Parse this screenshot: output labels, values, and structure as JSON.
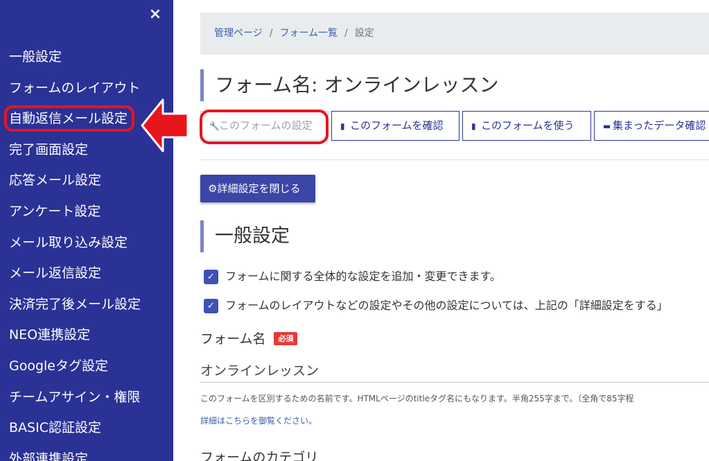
{
  "sidebar": {
    "close_label": "×",
    "items": [
      {
        "label": "一般設定"
      },
      {
        "label": "フォームのレイアウト"
      },
      {
        "label": "自動返信メール設定"
      },
      {
        "label": "完了画面設定"
      },
      {
        "label": "応答メール設定"
      },
      {
        "label": "アンケート設定"
      },
      {
        "label": "メール取り込み設定"
      },
      {
        "label": "メール返信設定"
      },
      {
        "label": "決済完了後メール設定"
      },
      {
        "label": "NEO連携設定"
      },
      {
        "label": "Googleタグ設定"
      },
      {
        "label": "チームアサイン・権限"
      },
      {
        "label": "BASIC認証設定"
      },
      {
        "label": "外部連携設定"
      }
    ]
  },
  "breadcrumb": {
    "home": "管理ページ",
    "list": "フォーム一覧",
    "current": "設定",
    "separator": "/"
  },
  "page_title": "フォーム名: オンラインレッスン",
  "tabs": [
    {
      "label": "このフォームの設定",
      "icon": "wrench-icon"
    },
    {
      "label": "このフォームを確認",
      "icon": "document-icon"
    },
    {
      "label": "このフォームを使う",
      "icon": "document-icon"
    },
    {
      "label": "集まったデータ確認",
      "icon": "message-icon"
    }
  ],
  "detail_button": {
    "label": "詳細設定を閉じる",
    "icon": "gear-icon"
  },
  "section_title": "一般設定",
  "checks": [
    {
      "text": "フォームに関する全体的な設定を追加・変更できます。",
      "checked": true
    },
    {
      "text": "フォームのレイアウトなどの設定やその他の設定については、上記の「詳細設定をする」",
      "checked": true
    }
  ],
  "form_name_field": {
    "label": "フォーム名",
    "required_badge": "必須",
    "value": "オンラインレッスン",
    "help": "このフォームを区別するための名前です。HTMLページのtitleタグ名にもなります。半角255字まで。（全角で85字程",
    "help_link": "詳細はこちらを御覧ください。"
  },
  "next_field_label": "フォームのカテゴリ",
  "colors": {
    "sidebar_bg": "#2b3296",
    "accent": "#3f51b5",
    "highlight": "#e8141b",
    "required": "#e53935"
  }
}
